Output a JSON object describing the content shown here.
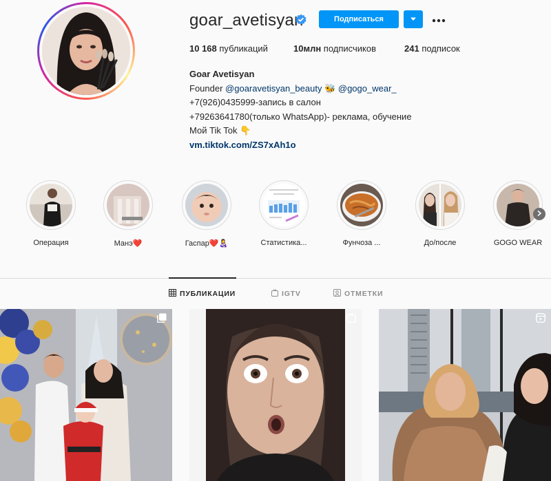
{
  "profile": {
    "username": "goar_avetisyan",
    "follow_label": "Подписаться",
    "stats": {
      "posts_count": "10 168",
      "posts_label": " публикаций",
      "followers_count": "10млн",
      "followers_label": " подписчиков",
      "following_count": "241",
      "following_label": " подписок"
    },
    "bio": {
      "full_name": "Goar Avetisyan",
      "line1_prefix": "Founder ",
      "line1_mention1": "@goaravetisyan_beauty",
      "line1_emoji": " 🐝 ",
      "line1_mention2": "@gogo_wear_",
      "line2": "+7(926)0435999-запись в салон",
      "line3": "+79263641780(только WhatsApp)- реклама, обучение",
      "line4": "Мой Tik Tok 👇",
      "url": "vm.tiktok.com/ZS7xAh1o"
    }
  },
  "highlights": [
    {
      "label": "Операция"
    },
    {
      "label": "Манэ❤️"
    },
    {
      "label": "Гаспар❤️👩‍🍼"
    },
    {
      "label": "Статистика..."
    },
    {
      "label": "Фунчоза ..."
    },
    {
      "label": "До/после"
    },
    {
      "label": "GOGO WEAR"
    }
  ],
  "tabs": [
    {
      "label": "ПУБЛИКАЦИИ",
      "icon": "grid-icon",
      "active": true
    },
    {
      "label": "IGTV",
      "icon": "igtv-icon",
      "active": false
    },
    {
      "label": "ОТМЕТКИ",
      "icon": "tagged-icon",
      "active": false
    }
  ],
  "colors": {
    "primary_button": "#0095f6",
    "link": "#00376b",
    "text": "#262626",
    "muted": "#8e8e8e",
    "background": "#fafafa"
  }
}
